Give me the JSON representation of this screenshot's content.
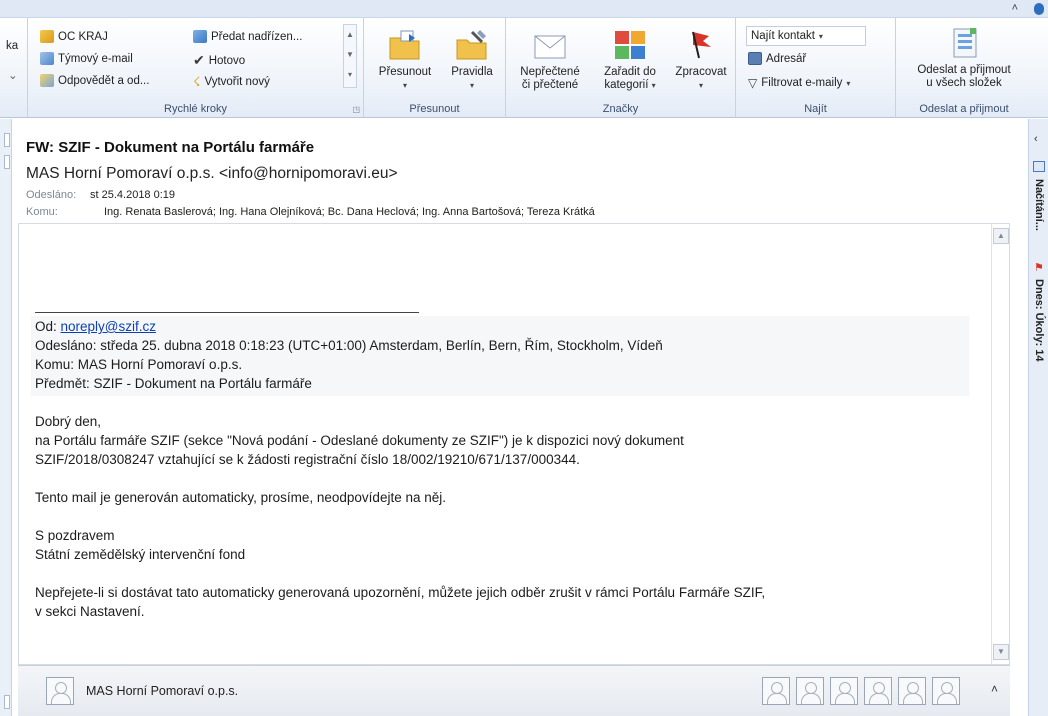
{
  "ribbon": {
    "partial_left_label": "ka",
    "quick_steps": {
      "items": [
        "OC KRAJ",
        "Předat nadřízen...",
        "Týmový e-mail",
        "Hotovo",
        "Odpovědět a od...",
        "Vytvořit nový"
      ],
      "group_label": "Rychlé kroky"
    },
    "move": {
      "move_label": "Přesunout",
      "rules_label": "Pravidla",
      "group_label": "Přesunout"
    },
    "tags": {
      "unread_line1": "Nepřečtené",
      "unread_line2": "či přečtené",
      "categorize_line1": "Zařadit do",
      "categorize_line2": "kategorií",
      "followup_label": "Zpracovat",
      "group_label": "Značky"
    },
    "find": {
      "find_contact": "Najít kontakt",
      "address_book": "Adresář",
      "filter_email": "Filtrovat e-maily",
      "group_label": "Najít"
    },
    "send_receive": {
      "line1": "Odeslat a přijmout",
      "line2": "u všech složek",
      "group_label": "Odeslat a přijmout"
    }
  },
  "message": {
    "subject": "FW: SZIF - Dokument na Portálu farmáře",
    "sender": "MAS Horní Pomoraví o.p.s. <info@hornipomoravi.eu>",
    "sent_label": "Odesláno:",
    "sent_value": "st 25.4.2018 0:19",
    "to_label": "Komu:",
    "to_value": "Ing. Renata Baslerová; Ing. Hana Olejníková; Bc. Dana Heclová; Ing. Anna Bartošová; Tereza Krátká"
  },
  "body": {
    "separator": "________________________________________",
    "from_label": "Od:",
    "from_link": "noreply@szif.cz",
    "sent_line": "Odesláno: středa 25. dubna 2018 0:18:23 (UTC+01:00) Amsterdam, Berlín, Bern, Řím, Stockholm, Vídeň",
    "to_line": "Komu: MAS Horní Pomoraví o.p.s.",
    "subject_line": "Předmět: SZIF - Dokument na Portálu farmáře",
    "greeting": "Dobrý den,",
    "para1_line1": "na Portálu farmáře SZIF (sekce \"Nová podání - Odeslané dokumenty ze SZIF\") je k dispozici nový dokument",
    "para1_line2": "SZIF/2018/0308247 vztahující se k žádosti registrační číslo 18/002/19210/671/137/000344.",
    "para2": "Tento mail je generován automaticky, prosíme, neodpovídejte na něj.",
    "closing1": "S pozdravem",
    "closing2": "Státní zemědělský intervenční fond",
    "para3_line1": "Nepřejete-li si dostávat tato automaticky generovaná upozornění, můžete jejich odběr zrušit v rámci Portálu Farmáře SZIF,",
    "para3_line2": "v sekci Nastavení."
  },
  "people_pane": {
    "name": "MAS Horní Pomoraví o.p.s."
  },
  "todo_bar": {
    "calendar_label": "Načítání...",
    "tasks_label": "Dnes: Úkoly: 14"
  }
}
